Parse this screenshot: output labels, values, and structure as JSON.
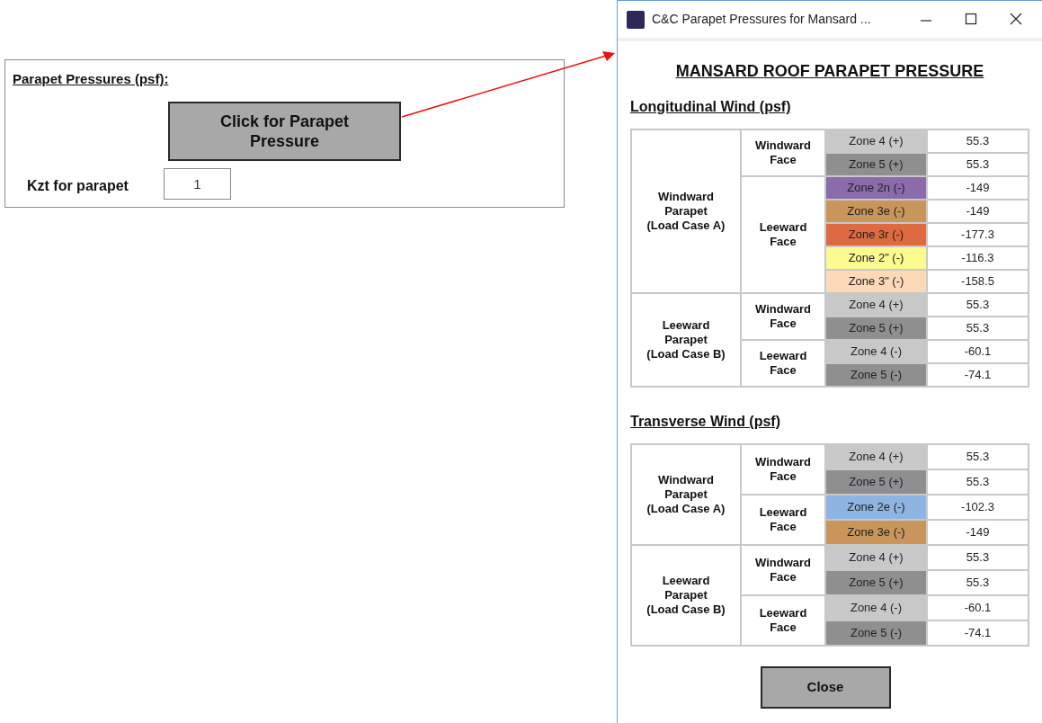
{
  "left_panel": {
    "title": "Parapet Pressures (psf):",
    "button": "Click for Parapet\nPressure",
    "kzt_label": "Kzt for parapet",
    "kzt_value": "1"
  },
  "dialog": {
    "title": "C&C Parapet Pressures for Mansard ...",
    "heading": "MANSARD ROOF PARAPET PRESSURE",
    "close_button": "Close",
    "sections": [
      {
        "title": "Longitudinal Wind (psf)",
        "groups": [
          {
            "label": "Windward\nParapet\n(Load Case A)",
            "faces": [
              {
                "label": "Windward\nFace",
                "zones": [
                  {
                    "zone": "Zone 4 (+)",
                    "color": "#c8c8c8",
                    "value": "55.3"
                  },
                  {
                    "zone": "Zone 5 (+)",
                    "color": "#8f8f8f",
                    "value": "55.3"
                  }
                ]
              },
              {
                "label": "Leeward\nFace",
                "zones": [
                  {
                    "zone": "Zone 2n (-)",
                    "color": "#8a6bab",
                    "value": "-149"
                  },
                  {
                    "zone": "Zone 3e (-)",
                    "color": "#c9955a",
                    "value": "-149"
                  },
                  {
                    "zone": "Zone 3r (-)",
                    "color": "#dd6b3f",
                    "value": "-177.3"
                  },
                  {
                    "zone": "Zone 2\" (-)",
                    "color": "#fbfb90",
                    "value": "-116.3"
                  },
                  {
                    "zone": "Zone 3\" (-)",
                    "color": "#fdd9b7",
                    "value": "-158.5"
                  }
                ]
              }
            ]
          },
          {
            "label": "Leeward\nParapet\n(Load Case B)",
            "faces": [
              {
                "label": "Windward\nFace",
                "zones": [
                  {
                    "zone": "Zone 4 (+)",
                    "color": "#c8c8c8",
                    "value": "55.3"
                  },
                  {
                    "zone": "Zone 5 (+)",
                    "color": "#8f8f8f",
                    "value": "55.3"
                  }
                ]
              },
              {
                "label": "Leeward\nFace",
                "zones": [
                  {
                    "zone": "Zone 4 (-)",
                    "color": "#c8c8c8",
                    "value": "-60.1"
                  },
                  {
                    "zone": "Zone 5 (-)",
                    "color": "#8f8f8f",
                    "value": "-74.1"
                  }
                ]
              }
            ]
          }
        ]
      },
      {
        "title": "Transverse Wind (psf)",
        "groups": [
          {
            "label": "Windward\nParapet\n(Load Case A)",
            "faces": [
              {
                "label": "Windward\nFace",
                "zones": [
                  {
                    "zone": "Zone 4 (+)",
                    "color": "#c8c8c8",
                    "value": "55.3"
                  },
                  {
                    "zone": "Zone 5 (+)",
                    "color": "#8f8f8f",
                    "value": "55.3"
                  }
                ]
              },
              {
                "label": "Leeward\nFace",
                "zones": [
                  {
                    "zone": "Zone 2e (-)",
                    "color": "#8db4e2",
                    "value": "-102.3"
                  },
                  {
                    "zone": "Zone 3e (-)",
                    "color": "#c9955a",
                    "value": "-149"
                  }
                ]
              }
            ]
          },
          {
            "label": "Leeward\nParapet\n(Load Case B)",
            "faces": [
              {
                "label": "Windward\nFace",
                "zones": [
                  {
                    "zone": "Zone 4 (+)",
                    "color": "#c8c8c8",
                    "value": "55.3"
                  },
                  {
                    "zone": "Zone 5 (+)",
                    "color": "#8f8f8f",
                    "value": "55.3"
                  }
                ]
              },
              {
                "label": "Leeward\nFace",
                "zones": [
                  {
                    "zone": "Zone 4 (-)",
                    "color": "#c8c8c8",
                    "value": "-60.1"
                  },
                  {
                    "zone": "Zone 5 (-)",
                    "color": "#8f8f8f",
                    "value": "-74.1"
                  }
                ]
              }
            ]
          }
        ]
      }
    ]
  }
}
